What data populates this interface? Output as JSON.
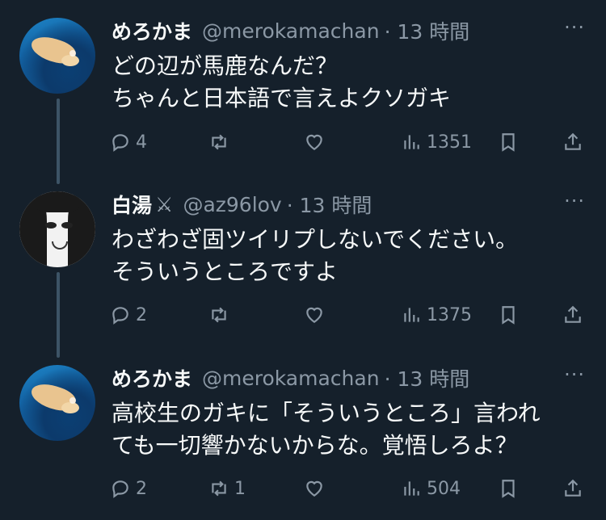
{
  "tweets": [
    {
      "name": "めろかま",
      "handle": "@merokamachan",
      "time": "· 13 時間",
      "more": "···",
      "text": "どの辺が馬鹿なんだ？\nちゃんと日本語で言えよクソガキ",
      "replies": "4",
      "retweets": "",
      "likes": "",
      "views": "1351",
      "avatar": "ocean"
    },
    {
      "name": "白湯",
      "name_emoji": "⚔",
      "handle": "@az96lov",
      "time": "· 13 時間",
      "more": "···",
      "text": "わざわざ固ツイリプしないでください。\nそういうところですよ",
      "replies": "2",
      "retweets": "",
      "likes": "",
      "views": "1375",
      "avatar": "anime"
    },
    {
      "name": "めろかま",
      "handle": "@merokamachan",
      "time": "· 13 時間",
      "more": "···",
      "text": "高校生のガキに「そういうところ」言われ\nても一切響かないからな。覚悟しろよ？",
      "replies": "2",
      "retweets": "1",
      "likes": "",
      "views": "504",
      "avatar": "ocean"
    }
  ],
  "colors": {
    "background": "#15202b",
    "text": "#f7f9f9",
    "secondary": "#8b98a5",
    "thread_line": "#3d5466"
  }
}
